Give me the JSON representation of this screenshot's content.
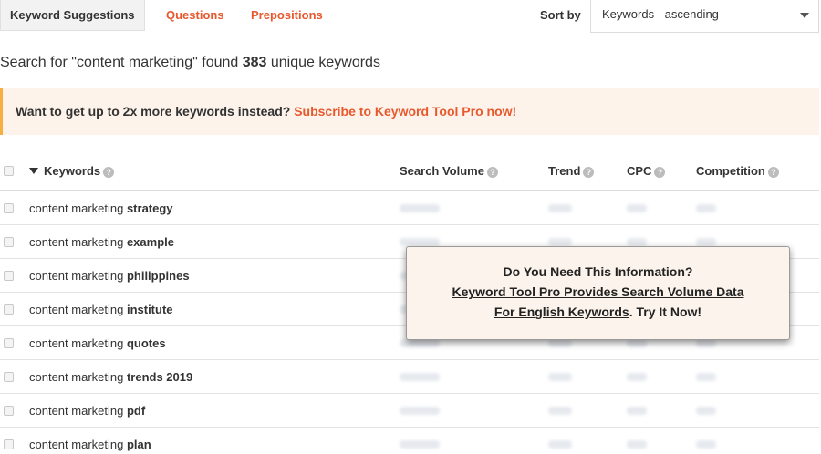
{
  "tabs": {
    "active": "Keyword Suggestions",
    "questions": "Questions",
    "prepositions": "Prepositions"
  },
  "sort": {
    "label": "Sort by",
    "selected": "Keywords - ascending"
  },
  "summary": {
    "prefix": "Search for \"content marketing\" found ",
    "count": "383",
    "suffix": " unique keywords"
  },
  "promo": {
    "text": "Want to get up to 2x more keywords instead? ",
    "link": "Subscribe to Keyword Tool Pro now!"
  },
  "table": {
    "headers": {
      "keywords": "Keywords",
      "search_volume": "Search Volume",
      "trend": "Trend",
      "cpc": "CPC",
      "competition": "Competition"
    },
    "help_glyph": "?",
    "rows": [
      {
        "base": "content marketing ",
        "bold": "strategy"
      },
      {
        "base": "content marketing ",
        "bold": "example"
      },
      {
        "base": "content marketing ",
        "bold": "philippines"
      },
      {
        "base": "content marketing ",
        "bold": "institute"
      },
      {
        "base": "content marketing ",
        "bold": "quotes"
      },
      {
        "base": "content marketing ",
        "bold": "trends 2019"
      },
      {
        "base": "content marketing ",
        "bold": "pdf"
      },
      {
        "base": "content marketing ",
        "bold": "plan"
      }
    ]
  },
  "popup": {
    "line1": "Do You Need This Information?",
    "line2": "Keyword Tool Pro Provides Search Volume Data",
    "line3_link": "For English Keywords",
    "line3_rest": ". Try It Now!"
  },
  "colors": {
    "accent": "#e8582d",
    "promo_bg": "#fdf3ea",
    "promo_border": "#f5b041"
  }
}
